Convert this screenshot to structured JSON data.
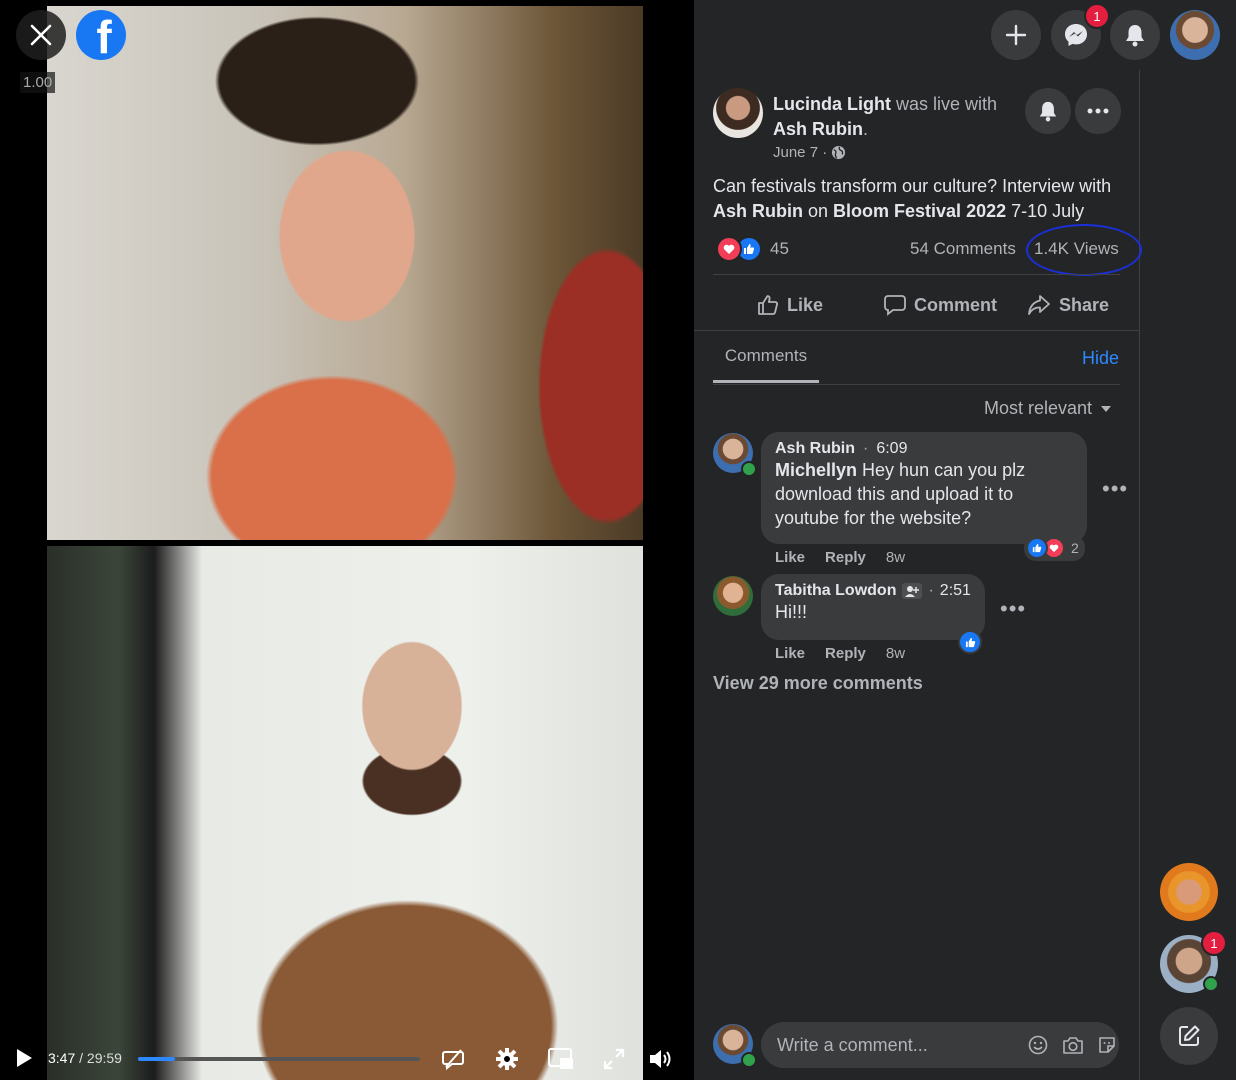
{
  "video": {
    "speed_label": "1.00",
    "current_time": "3:47",
    "total_time": "/ 29:59",
    "progress_percent": 13
  },
  "topbar": {
    "messenger_badge": "1"
  },
  "post": {
    "author": "Lucinda Light",
    "live_with_text": "was live with",
    "guest": "Ash Rubin",
    "guest_suffix": ".",
    "date": "June 7 ·",
    "text_part1": "Can festivals transform our culture? Interview with ",
    "text_bold1": "Ash Rubin",
    "text_part2": " on ",
    "text_bold2": "Bloom Festival 2022",
    "text_part3": " 7-10 July",
    "reaction_count": "45",
    "comment_count": "54 Comments",
    "view_count": "1.4K Views"
  },
  "actions": {
    "like": "Like",
    "comment": "Comment",
    "share": "Share"
  },
  "comments_section": {
    "tab_label": "Comments",
    "hide_label": "Hide",
    "sort_label": "Most relevant",
    "view_more": "View 29 more comments",
    "composer_placeholder": "Write a comment..."
  },
  "comments": [
    {
      "name": "Ash Rubin",
      "separator": "·",
      "time": "6:09",
      "mention": "Michellyn",
      "text": " Hey hun can you plz download this and upload it to youtube for the website?",
      "like": "Like",
      "reply": "Reply",
      "age": "8w",
      "reaction_count": "2"
    },
    {
      "name": "Tabitha Lowdon",
      "separator": "·",
      "time": "2:51",
      "text": "Hi!!!",
      "like": "Like",
      "reply": "Reply",
      "age": "8w"
    }
  ],
  "sidebar": {
    "contact_badge": "1"
  },
  "colors": {
    "accent": "#2d88ff",
    "badge": "#e41e3f",
    "panel_bg": "#242526",
    "annotation_circle": "#1a2fd6"
  }
}
